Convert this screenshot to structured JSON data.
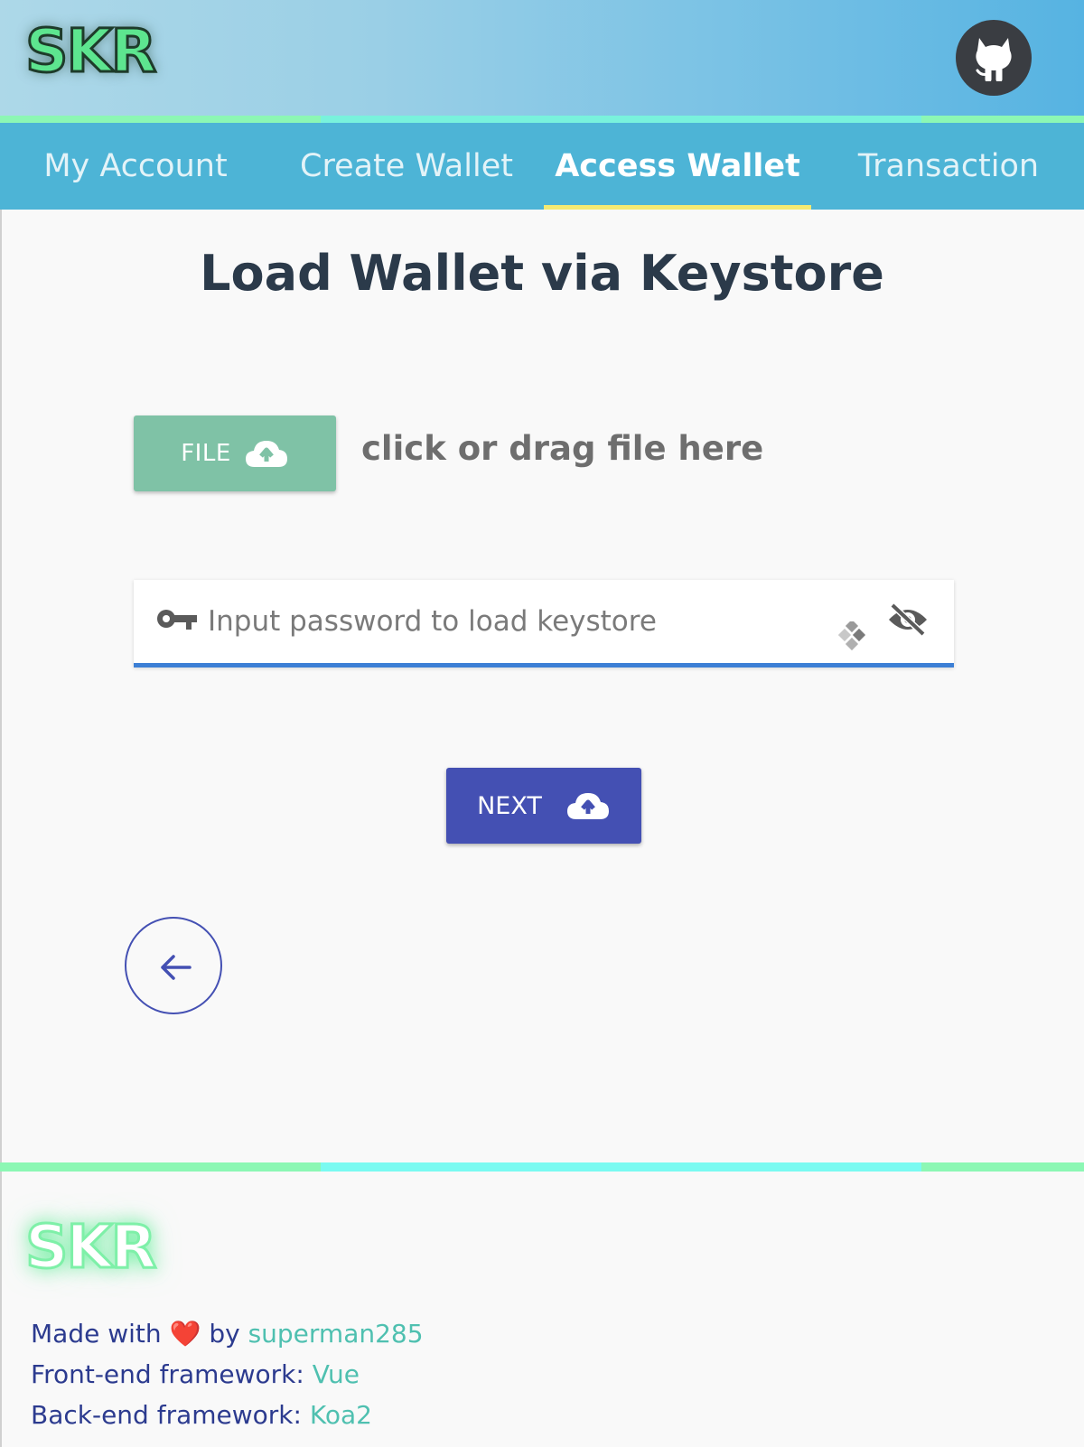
{
  "header": {
    "logo": "SKR",
    "github_icon": "github-octocat-icon"
  },
  "tabs": [
    {
      "label": "My Account",
      "active": false
    },
    {
      "label": "Create Wallet",
      "active": false
    },
    {
      "label": "Access Wallet",
      "active": true
    },
    {
      "label": "Transaction",
      "active": false
    }
  ],
  "main": {
    "title": "Load Wallet via Keystore",
    "file_button": {
      "label": "FILE",
      "icon": "cloud-upload-icon"
    },
    "drag_hint": "click or drag file here",
    "password": {
      "placeholder": "Input password to load keystore",
      "value": "",
      "prefix_icon": "key-icon",
      "suffix_icon": "eye-off-icon"
    },
    "next_button": {
      "label": "NEXT",
      "icon": "cloud-upload-icon"
    },
    "back_icon": "arrow-left-icon"
  },
  "footer": {
    "logo": "SKR",
    "made_with": "Made with",
    "heart": "❤️",
    "by": "by",
    "author": "superman285",
    "frontend_label": "Front-end framework:",
    "frontend_value": "Vue",
    "backend_label": "Back-end framework:",
    "backend_value": "Koa2"
  },
  "colors": {
    "header_gradient_start": "#add8e8",
    "header_gradient_end": "#56b3e2",
    "tab_bar": "#4db4d6",
    "active_underline": "#f4ea73",
    "file_button": "#7fc2a6",
    "next_button": "#4450b3",
    "input_underline": "#3c7fd5",
    "title_text": "#2b3a4a",
    "logo_green": "#5de58f",
    "link": "#4fc0b0"
  }
}
